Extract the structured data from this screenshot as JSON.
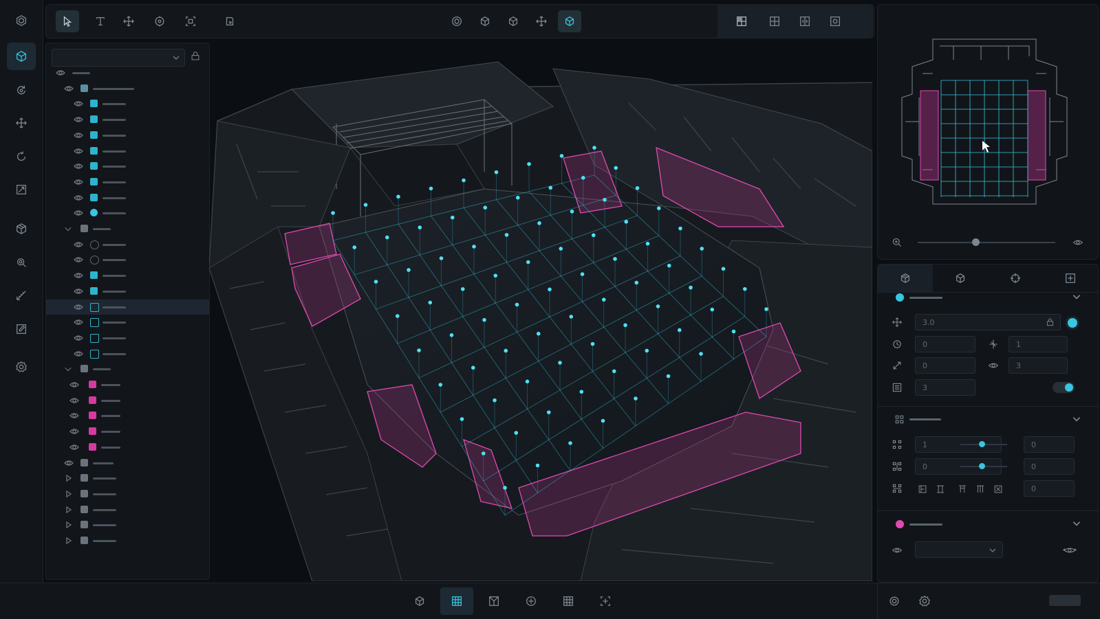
{
  "window": {
    "title": ""
  },
  "colors": {
    "accent": "#38c6e0",
    "magenta": "#d63aa0",
    "panel": "#12161b",
    "background": "#0b0e12"
  },
  "left_rail": {
    "items": [
      {
        "name": "app-logo-icon"
      },
      {
        "name": "model-cube-icon",
        "active": true
      },
      {
        "name": "refresh-pin-icon"
      },
      {
        "name": "move-arrows-icon"
      },
      {
        "name": "rotate-icon"
      },
      {
        "name": "scale-square-icon"
      },
      {
        "name": "package-icon"
      },
      {
        "name": "settings-search-icon"
      },
      {
        "name": "measure-icon"
      },
      {
        "name": "edit-square-icon"
      },
      {
        "name": "gear-icon"
      }
    ],
    "bottom_icon": "layers-icon"
  },
  "toolbar": {
    "left_tools": [
      "select-arrow-icon",
      "text-tool-icon",
      "move-tool-icon",
      "rotate-tool-icon",
      "frame-tool-icon",
      "snap-icon"
    ],
    "center_tools": [
      "orbit-icon",
      "box-icon",
      "box-alt-icon",
      "pan-icon",
      "box-active-icon"
    ],
    "right_tools": [
      "layout-grid-icon",
      "layout-split-icon",
      "layout-compare-icon",
      "layout-fit-icon"
    ]
  },
  "outliner": {
    "layer_select_value": "",
    "tree": [
      {
        "level": 0,
        "icon": "eye",
        "bar": 26
      },
      {
        "level": 1,
        "icon": "building",
        "bar": 60
      },
      {
        "level": 2,
        "icon": "cyan",
        "bar": 34
      },
      {
        "level": 2,
        "icon": "cyan",
        "bar": 34
      },
      {
        "level": 2,
        "icon": "cyan",
        "bar": 34
      },
      {
        "level": 2,
        "icon": "cyan",
        "bar": 34
      },
      {
        "level": 2,
        "icon": "cyan",
        "bar": 34
      },
      {
        "level": 2,
        "icon": "cyan",
        "bar": 34
      },
      {
        "level": 2,
        "icon": "cyan",
        "bar": 34
      },
      {
        "level": 2,
        "icon": "cyan-dot",
        "bar": 34
      },
      {
        "level": 1,
        "icon": "folder",
        "bar": 26
      },
      {
        "level": 2,
        "icon": "gray-circle",
        "bar": 34
      },
      {
        "level": 2,
        "icon": "gray-circle",
        "bar": 34
      },
      {
        "level": 2,
        "icon": "cyan",
        "bar": 34
      },
      {
        "level": 2,
        "icon": "cyan",
        "bar": 34
      },
      {
        "level": 2,
        "icon": "cyan-outline",
        "bar": 34,
        "selected": true
      },
      {
        "level": 2,
        "icon": "cyan-outline",
        "bar": 34
      },
      {
        "level": 2,
        "icon": "cyan-outline",
        "bar": 34
      },
      {
        "level": 2,
        "icon": "cyan-outline",
        "bar": 34
      },
      {
        "level": 1,
        "icon": "folder",
        "bar": 26
      },
      {
        "level": 3,
        "icon": "magenta",
        "bar": 28
      },
      {
        "level": 3,
        "icon": "magenta",
        "bar": 28
      },
      {
        "level": 3,
        "icon": "magenta",
        "bar": 28
      },
      {
        "level": 3,
        "icon": "magenta",
        "bar": 28
      },
      {
        "level": 3,
        "icon": "magenta",
        "bar": 28
      },
      {
        "level": 1,
        "icon": "gray",
        "bar": 30
      },
      {
        "level": 1,
        "icon": "gray",
        "bar": 34
      },
      {
        "level": 1,
        "icon": "gray",
        "bar": 34
      },
      {
        "level": 1,
        "icon": "gray",
        "bar": 34
      },
      {
        "level": 1,
        "icon": "gray",
        "bar": 34
      },
      {
        "level": 1,
        "icon": "gray",
        "bar": 34
      }
    ]
  },
  "minimap": {
    "zoom_level": 0.42
  },
  "properties": {
    "tabs": [
      "model-tab-icon",
      "cube-tab-icon",
      "target-tab-icon",
      "add-tab-icon"
    ],
    "section_transform": {
      "position_value": "3.0",
      "rotation_value": "0",
      "scale_value": "1",
      "offset_value": "0",
      "visibility_value": "3",
      "layer_value": "3",
      "toggle_on": true
    },
    "section_grid": {
      "row1_value": "1",
      "row1_slider": 0.45,
      "row1_right": "0",
      "row2_value": "0",
      "row2_slider": 0.45,
      "row2_right": "0",
      "row3_right": "0"
    },
    "section_material": {
      "select_value": ""
    }
  },
  "bottombar": {
    "center_tools": [
      "cube-view-icon",
      "grid-view-icon",
      "section-view-icon",
      "target-view-icon",
      "table-grid-icon",
      "add-frame-icon"
    ],
    "active_index": 1,
    "right_tools": [
      "settings-icon",
      "gear-alt-icon"
    ]
  }
}
